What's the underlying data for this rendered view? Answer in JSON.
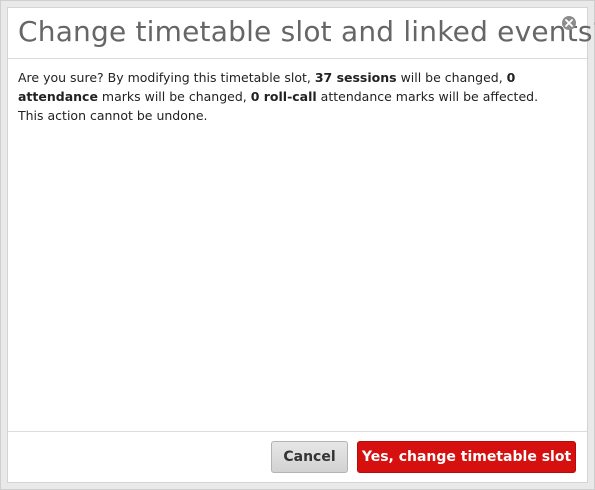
{
  "dialog": {
    "title": "Change timetable slot and linked events?",
    "close_icon": "close-circle-icon",
    "message": {
      "part1": "Are you sure? By modifying this timetable slot, ",
      "sessions_count": "37 sessions",
      "part2": " will be changed, ",
      "attendance_count": "0 attendance",
      "part3": " marks will be changed, ",
      "rollcall_count": "0 roll-call",
      "part4": " attendance marks will be affected. This action cannot be undone."
    },
    "buttons": {
      "cancel_label": "Cancel",
      "confirm_label": "Yes, change timetable slot"
    }
  },
  "colors": {
    "confirm_button": "#d60f0f",
    "title_text": "#666666"
  }
}
